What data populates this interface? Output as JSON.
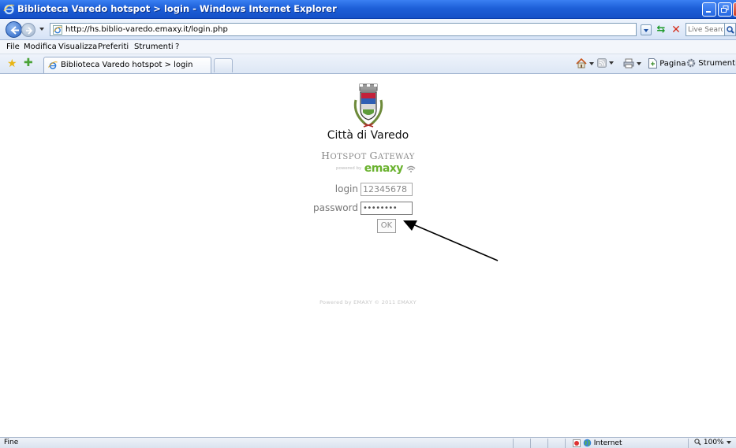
{
  "window": {
    "title": "Biblioteca Varedo hotspot > login - Windows Internet Explorer",
    "controls": {
      "minimize": "minimize",
      "maximize": "maximize",
      "close": "close"
    }
  },
  "address_bar": {
    "url": "http://hs.biblio-varedo.emaxy.it/login.php",
    "search_placeholder": "Live Search"
  },
  "menu": {
    "items": [
      "File",
      "Modifica",
      "Visualizza",
      "Preferiti",
      "Strumenti",
      "?"
    ]
  },
  "tabs": [
    {
      "label": "Biblioteca Varedo hotspot > login",
      "active": true
    }
  ],
  "command_bar": {
    "pagina": "Pagina",
    "strumenti": "Strumenti"
  },
  "page": {
    "city_name": "Città di Varedo",
    "gateway_title_a": "H",
    "gateway_title_b": "OTSPOT ",
    "gateway_title_c": "G",
    "gateway_title_d": "ATEWAY",
    "powered_by": "powered by",
    "brand": "emaxy",
    "form": {
      "login_label": "login",
      "login_value": "12345678",
      "password_label": "password",
      "password_value": "••••••••",
      "ok_label": "OK"
    },
    "footer": "Powered by EMAXY © 2011 EMAXY"
  },
  "status_bar": {
    "status": "Fine",
    "zone": "Internet",
    "zoom": "100%"
  },
  "colors": {
    "titlebar": "#1d5fd8",
    "brand_green": "#6ab22f",
    "annotation_arrow": "#000000"
  }
}
